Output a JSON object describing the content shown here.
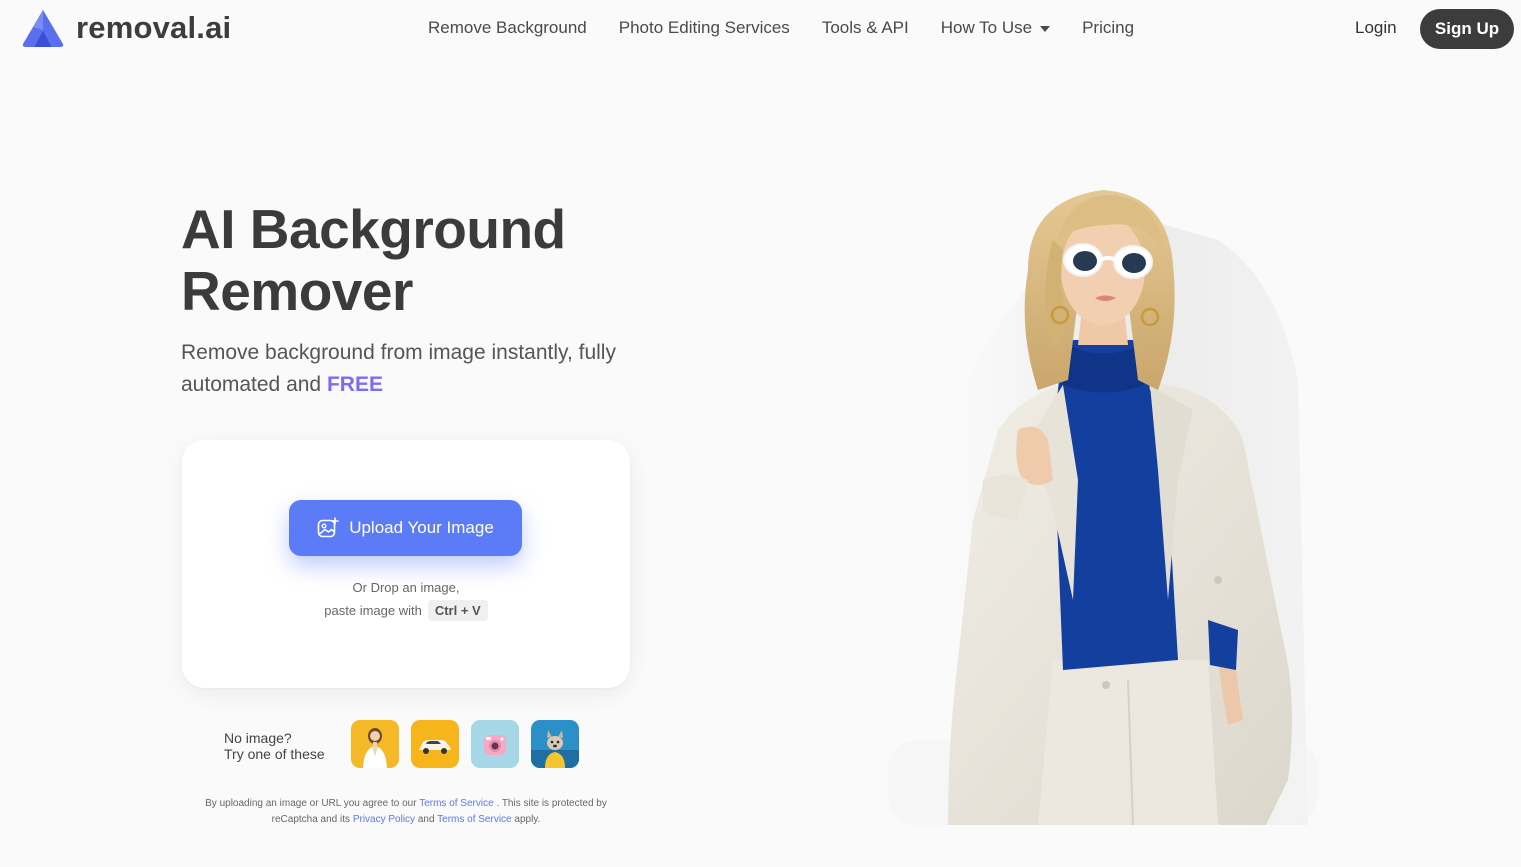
{
  "brand": {
    "name": "removal.ai"
  },
  "nav": {
    "items": [
      {
        "label": "Remove Background"
      },
      {
        "label": "Photo Editing Services"
      },
      {
        "label": "Tools & API"
      },
      {
        "label": "How To Use"
      },
      {
        "label": "Pricing"
      }
    ],
    "login": "Login",
    "signup": "Sign Up"
  },
  "hero": {
    "title": "AI Background Remover",
    "subtitle_start": "Remove background from image instantly, fully automated and",
    "subtitle_highlight": "FREE"
  },
  "upload": {
    "button_label": "Upload Your Image",
    "drop_text": "Or Drop an image,",
    "paste_text": "paste image with",
    "shortcut": "Ctrl + V"
  },
  "samples": {
    "label_line1": "No image?",
    "label_line2": "Try one of these"
  },
  "legal": {
    "part1": "By uploading an image or URL you agree to our",
    "terms1": "Terms of Service",
    "part2": ". This site is protected by reCaptcha and its",
    "privacy": "Privacy Policy",
    "part3": "and",
    "terms2": "Terms of Service",
    "part4": "apply."
  },
  "colors": {
    "accent": "#5b7cf6",
    "highlight": "#7b6cf6",
    "signup_bg": "#3c3c3c",
    "background": "#fafafa"
  },
  "icons": {
    "logo": "removal-logo-icon",
    "upload": "image-upload-icon",
    "dropdown": "chevron-down-icon"
  }
}
